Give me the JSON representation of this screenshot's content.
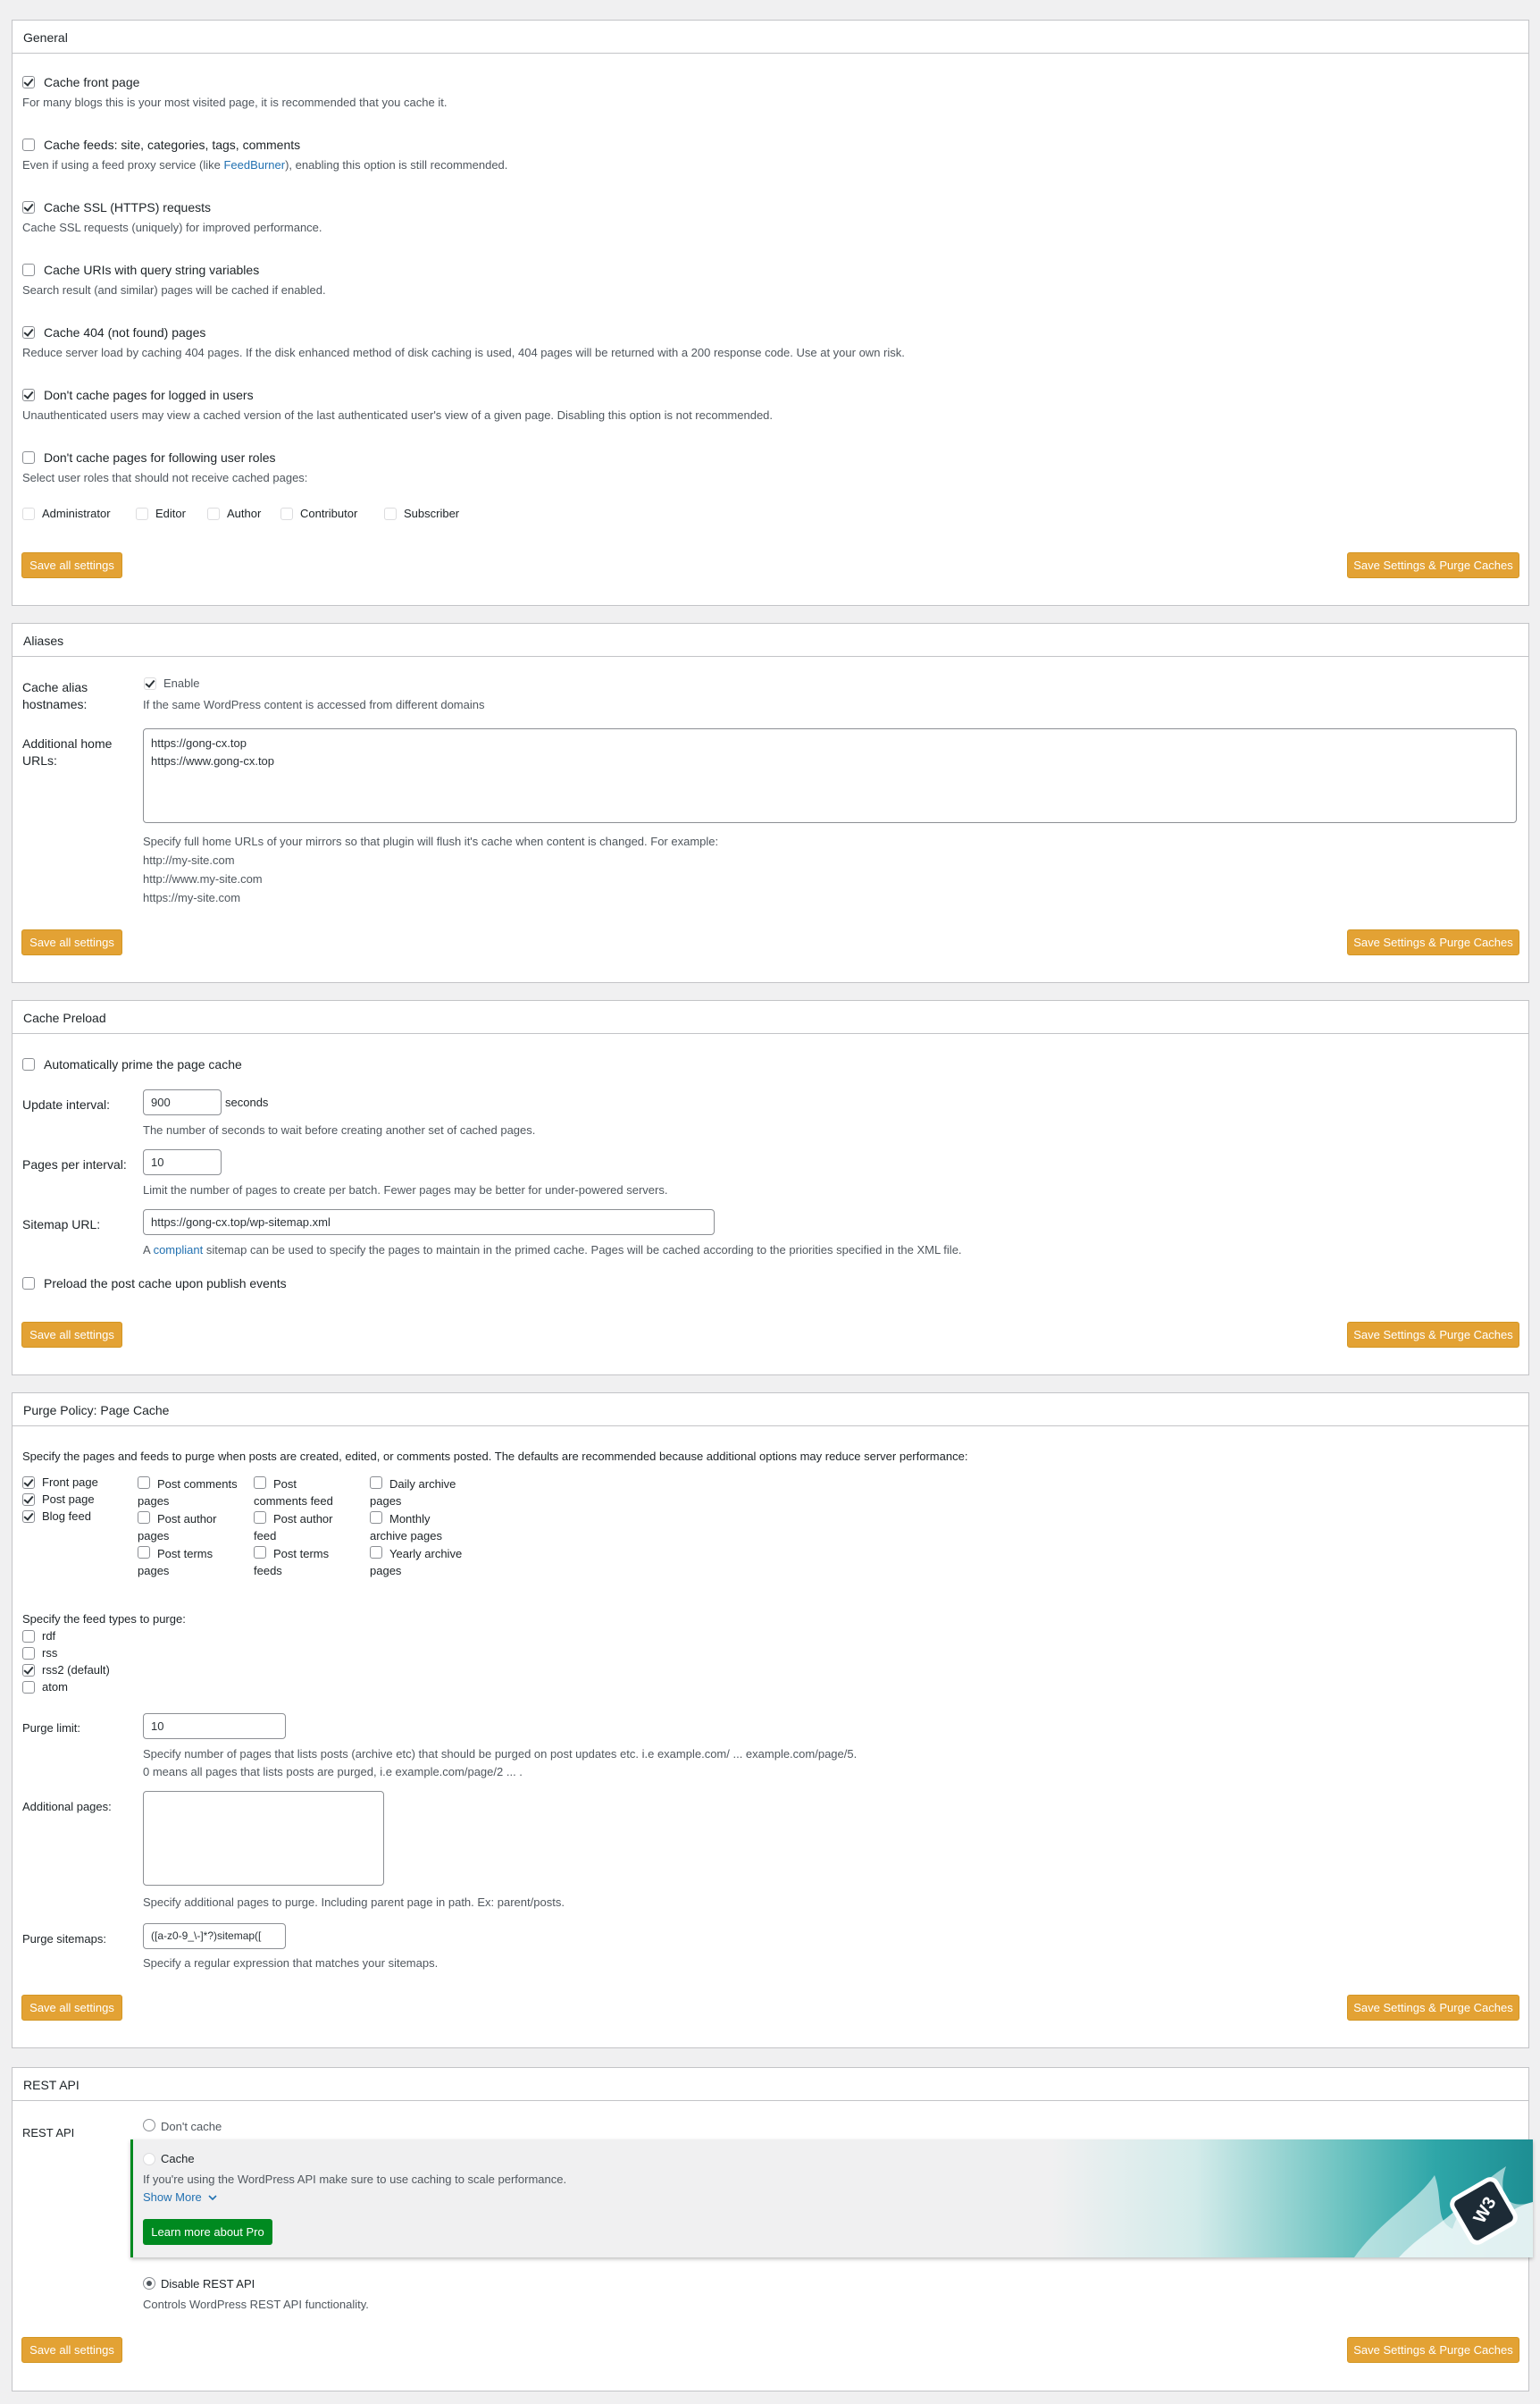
{
  "buttons": {
    "save": "Save all settings",
    "purge": "Save Settings & Purge Caches"
  },
  "general": {
    "title": "General",
    "options": [
      {
        "label": "Cache front page",
        "desc": "For many blogs this is your most visited page, it is recommended that you cache it.",
        "checked": true
      },
      {
        "label": "Cache feeds: site, categories, tags, comments",
        "desc_pre": "Even if using a feed proxy service (like ",
        "desc_link": "FeedBurner",
        "desc_post": "), enabling this option is still recommended.",
        "checked": false
      },
      {
        "label": "Cache SSL (HTTPS) requests",
        "desc": "Cache SSL requests (uniquely) for improved performance.",
        "checked": true
      },
      {
        "label": "Cache URIs with query string variables",
        "desc": "Search result (and similar) pages will be cached if enabled.",
        "checked": false
      },
      {
        "label": "Cache 404 (not found) pages",
        "desc": "Reduce server load by caching 404 pages. If the disk enhanced method of disk caching is used, 404 pages will be returned with a 200 response code. Use at your own risk.",
        "checked": true
      },
      {
        "label": "Don't cache pages for logged in users",
        "desc": "Unauthenticated users may view a cached version of the last authenticated user's view of a given page. Disabling this option is not recommended.",
        "checked": true
      },
      {
        "label": "Don't cache pages for following user roles",
        "desc": "Select user roles that should not receive cached pages:",
        "checked": false
      }
    ],
    "roles": [
      "Administrator",
      "Editor",
      "Author",
      "Contributor",
      "Subscriber"
    ]
  },
  "aliases": {
    "title": "Aliases",
    "alias_label": "Cache alias hostnames:",
    "enable_label": "Enable",
    "enable_desc": "If the same WordPress content is accessed from different domains",
    "home_label": "Additional home URLs:",
    "home_value": "https://gong-cx.top\nhttps://www.gong-cx.top",
    "home_desc": "Specify full home URLs of your mirrors so that plugin will flush it's cache when content is changed. For example:",
    "examples": [
      "http://my-site.com",
      "http://www.my-site.com",
      "https://my-site.com"
    ]
  },
  "preload": {
    "title": "Cache Preload",
    "auto_label": "Automatically prime the page cache",
    "interval_label": "Update interval:",
    "interval_value": "900",
    "interval_unit": "seconds",
    "interval_desc": "The number of seconds to wait before creating another set of cached pages.",
    "pages_label": "Pages per interval:",
    "pages_value": "10",
    "pages_desc": "Limit the number of pages to create per batch. Fewer pages may be better for under-powered servers.",
    "sitemap_label": "Sitemap URL:",
    "sitemap_value": "https://gong-cx.top/wp-sitemap.xml",
    "sitemap_desc_pre": "A ",
    "sitemap_desc_link": "compliant",
    "sitemap_desc_post": " sitemap can be used to specify the pages to maintain in the primed cache. Pages will be cached according to the priorities specified in the XML file.",
    "publish_label": "Preload the post cache upon publish events"
  },
  "purge": {
    "title": "Purge Policy: Page Cache",
    "intro": "Specify the pages and feeds to purge when posts are created, edited, or comments posted. The defaults are recommended because additional options may reduce server performance:",
    "col1": [
      {
        "label": "Front page",
        "checked": true
      },
      {
        "label": "Post page",
        "checked": true
      },
      {
        "label": "Blog feed",
        "checked": true
      }
    ],
    "col2": [
      {
        "label": "Post comments pages",
        "checked": false
      },
      {
        "label": "Post author pages",
        "checked": false
      },
      {
        "label": "Post terms pages",
        "checked": false
      }
    ],
    "col3": [
      {
        "label": "Post comments feed",
        "checked": false
      },
      {
        "label": "Post author feed",
        "checked": false
      },
      {
        "label": "Post terms feeds",
        "checked": false
      }
    ],
    "col4": [
      {
        "label": "Daily archive pages",
        "checked": false
      },
      {
        "label": "Monthly archive pages",
        "checked": false
      },
      {
        "label": "Yearly archive pages",
        "checked": false
      }
    ],
    "feed_types_label": "Specify the feed types to purge:",
    "feeds": [
      {
        "label": "rdf",
        "checked": false
      },
      {
        "label": "rss",
        "checked": false
      },
      {
        "label": "rss2 (default)",
        "checked": true
      },
      {
        "label": "atom",
        "checked": false
      }
    ],
    "limit_label": "Purge limit:",
    "limit_value": "10",
    "limit_desc1": "Specify number of pages that lists posts (archive etc) that should be purged on post updates etc. i.e example.com/ ... example.com/page/5.",
    "limit_desc2": "0 means all pages that lists posts are purged, i.e example.com/page/2 ... .",
    "additional_label": "Additional pages:",
    "additional_desc": "Specify additional pages to purge. Including parent page in path. Ex: parent/posts.",
    "sitemaps_label": "Purge sitemaps:",
    "sitemaps_value": "([a-z0-9_\\-]*?)sitemap([",
    "sitemaps_desc": "Specify a regular expression that matches your sitemaps."
  },
  "rest": {
    "title": "REST API",
    "label": "REST API",
    "opt_dont": "Don't cache",
    "opt_cache": "Cache",
    "promo_text": "If you're using the WordPress API make sure to use caching to scale performance.",
    "show_more": "Show More",
    "learn_more": "Learn more about Pro",
    "opt_disable": "Disable REST API",
    "disable_desc": "Controls WordPress REST API functionality.",
    "badge": "W3"
  }
}
